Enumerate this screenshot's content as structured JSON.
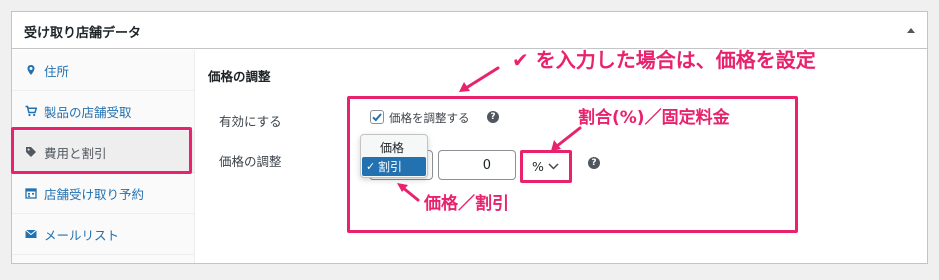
{
  "panel": {
    "title": "受け取り店舗データ"
  },
  "sidebar": {
    "items": [
      {
        "label": "住所",
        "icon": "location-pin-icon",
        "active": false
      },
      {
        "label": "製品の店舗受取",
        "icon": "cart-icon",
        "active": false
      },
      {
        "label": "費用と割引",
        "icon": "tag-icon",
        "active": true
      },
      {
        "label": "店舗受け取り予約",
        "icon": "calendar-icon",
        "active": false
      },
      {
        "label": "メールリスト",
        "icon": "mail-icon",
        "active": false
      }
    ]
  },
  "main": {
    "section_heading": "価格の調整",
    "enable_row": {
      "label": "有効にする",
      "checkbox_label": "価格を調整する",
      "checked": true
    },
    "adjust_row": {
      "label": "価格の調整",
      "type_options": [
        "価格",
        "割引"
      ],
      "type_selected": "割引",
      "amount_value": "0",
      "unit_value": "%"
    },
    "help_glyph": "?"
  },
  "annotations": {
    "top": "✔ を入力した場合は、価格を設定",
    "unit": "割合(%)／固定料金",
    "type": "価格／割引"
  },
  "colors": {
    "accent": "#e8226d",
    "link": "#2271b1",
    "selected": "#2271b1"
  }
}
